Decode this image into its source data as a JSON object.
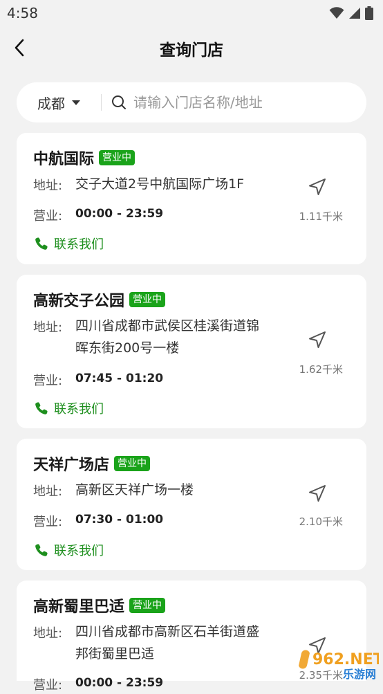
{
  "status_bar": {
    "time": "4:58"
  },
  "header": {
    "title": "查询门店"
  },
  "search": {
    "city": "成都",
    "placeholder": "请输入门店名称/地址"
  },
  "labels": {
    "address": "地址:",
    "hours": "营业:",
    "contact": "联系我们"
  },
  "stores": [
    {
      "name": "中航国际",
      "status": "营业中",
      "address_lines": [
        "交子大道2号中航国际广场1F"
      ],
      "hours": "00:00 - 23:59",
      "distance": "1.11千米"
    },
    {
      "name": "高新交子公园",
      "status": "营业中",
      "address_lines": [
        "四川省成都市武侯区桂溪街道锦",
        "晖东街200号一楼"
      ],
      "hours": "07:45 - 01:20",
      "distance": "1.62千米"
    },
    {
      "name": "天祥广场店",
      "status": "营业中",
      "address_lines": [
        "高新区天祥广场一楼"
      ],
      "hours": "07:30 - 01:00",
      "distance": "2.10千米"
    },
    {
      "name": "高新蜀里巴适",
      "status": "营业中",
      "address_lines": [
        "四川省成都市高新区石羊街道盛",
        "邦街蜀里巴适"
      ],
      "hours": "00:00 - 23:59",
      "distance": "2.35千米"
    }
  ],
  "watermark": {
    "text": "962.NET",
    "sub": "乐游网"
  },
  "colors": {
    "accent_green": "#1aa31a",
    "background": "#f2f2f2",
    "card": "#ffffff"
  }
}
